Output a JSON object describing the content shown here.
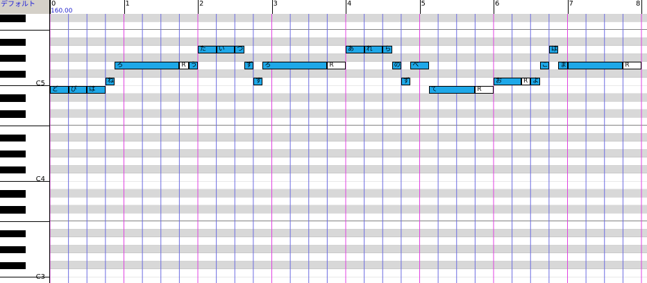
{
  "preset_label": "デフォルト",
  "tempo_label": "160.00",
  "bar_labels": [
    "0",
    "1",
    "2",
    "3",
    "4",
    "5",
    "6",
    "7",
    "8"
  ],
  "octave_labels": {
    "c5": "C5",
    "c4": "C4",
    "c3": "C3"
  },
  "colors": {
    "note": "#1ea8e8",
    "bar_line": "#e040e0",
    "beat_line": "#6a6ae0",
    "gray_row": "#d8d8d8"
  },
  "notes": [
    {
      "pitch": "E4",
      "start": 0.0,
      "dur": 0.25,
      "lyric": "ど"
    },
    {
      "pitch": "E4",
      "start": 0.25,
      "dur": 0.25,
      "lyric": "ぴ"
    },
    {
      "pitch": "E4",
      "start": 0.5,
      "dur": 0.25,
      "lyric": "は"
    },
    {
      "pitch": "F4",
      "start": 0.75,
      "dur": 0.125,
      "lyric": "ね"
    },
    {
      "pitch": "G4",
      "start": 0.875,
      "dur": 0.875,
      "lyric": "ろ"
    },
    {
      "pitch": "G4",
      "start": 1.75,
      "dur": 0.125,
      "lyric": "R",
      "rest": true
    },
    {
      "pitch": "G4",
      "start": 1.875,
      "dur": 0.125,
      "lyric": "う"
    },
    {
      "pitch": "A4",
      "start": 2.0,
      "dur": 0.25,
      "lyric": "た"
    },
    {
      "pitch": "A4",
      "start": 2.25,
      "dur": 0.25,
      "lyric": "い"
    },
    {
      "pitch": "A4",
      "start": 2.5,
      "dur": 0.125,
      "lyric": "つ"
    },
    {
      "pitch": "G4",
      "start": 2.625,
      "dur": 0.125,
      "lyric": "ず"
    },
    {
      "pitch": "F4",
      "start": 2.75,
      "dur": 0.125,
      "lyric": "す"
    },
    {
      "pitch": "G4",
      "start": 2.875,
      "dur": 0.875,
      "lyric": "ろ"
    },
    {
      "pitch": "G4",
      "start": 3.75,
      "dur": 0.25,
      "lyric": "R",
      "rest": true
    },
    {
      "pitch": "A4",
      "start": 4.0,
      "dur": 0.25,
      "lyric": "あ"
    },
    {
      "pitch": "A4",
      "start": 4.25,
      "dur": 0.25,
      "lyric": "れ"
    },
    {
      "pitch": "A4",
      "start": 4.5,
      "dur": 0.125,
      "lyric": "ら"
    },
    {
      "pitch": "G4",
      "start": 4.625,
      "dur": 0.125,
      "lyric": "の"
    },
    {
      "pitch": "F4",
      "start": 4.75,
      "dur": 0.125,
      "lyric": "ず"
    },
    {
      "pitch": "G4",
      "start": 4.875,
      "dur": 0.25,
      "lyric": "べ"
    },
    {
      "pitch": "E4",
      "start": 5.125,
      "dur": 0.625,
      "lyric": "て"
    },
    {
      "pitch": "E4",
      "start": 5.75,
      "dur": 0.25,
      "lyric": "R",
      "rest": true
    },
    {
      "pitch": "F4",
      "start": 6.0,
      "dur": 0.375,
      "lyric": "お"
    },
    {
      "pitch": "F4",
      "start": 6.375,
      "dur": 0.125,
      "lyric": "R",
      "rest": true
    },
    {
      "pitch": "F4",
      "start": 6.5,
      "dur": 0.125,
      "lyric": "よ"
    },
    {
      "pitch": "G4",
      "start": 6.625,
      "dur": 0.125,
      "lyric": "こ"
    },
    {
      "pitch": "A4",
      "start": 6.75,
      "dur": 0.125,
      "lyric": "は"
    },
    {
      "pitch": "G4",
      "start": 6.875,
      "dur": 0.125,
      "lyric": "ま"
    },
    {
      "pitch": "G4",
      "start": 7.0,
      "dur": 0.75,
      "lyric": ""
    },
    {
      "pitch": "G4",
      "start": 7.75,
      "dur": 0.25,
      "lyric": "R",
      "rest": true
    }
  ]
}
